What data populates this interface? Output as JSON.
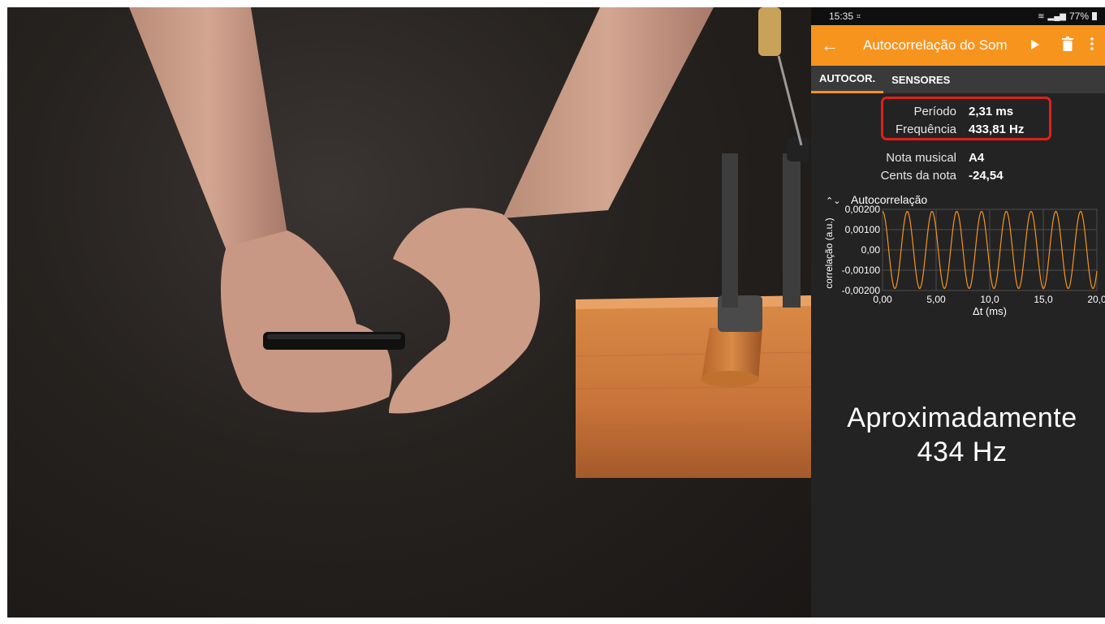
{
  "status_bar": {
    "time": "15:35",
    "battery": "77%"
  },
  "app_bar": {
    "title": "Autocorrelação do Som"
  },
  "tabs": [
    {
      "label": "AUTOCOR."
    },
    {
      "label": "SENSORES"
    }
  ],
  "readout": {
    "period_label": "Período",
    "period_value": "2,31 ms",
    "frequency_label": "Frequência",
    "frequency_value": "433,81 Hz",
    "note_label": "Nota musical",
    "note_value": "A4",
    "cents_label": "Cents da nota",
    "cents_value": "-24,54"
  },
  "chart_data": {
    "type": "line",
    "title": "Autocorrelação",
    "xlabel": "Δt (ms)",
    "ylabel": "correlação (a.u.)",
    "xlim": [
      0,
      20
    ],
    "ylim": [
      -0.002,
      0.002
    ],
    "x_ticks": [
      "0,00",
      "5,00",
      "10,0",
      "15,0",
      "20,0"
    ],
    "y_ticks": [
      "0,00200",
      "0,00100",
      "0,00",
      "-0,00100",
      "-0,00200"
    ],
    "series": [
      {
        "period_ms": 2.31,
        "amplitude": 0.0019,
        "color": "#f7941d"
      }
    ],
    "grid": true
  },
  "caption": {
    "line1": "Aproximadamente",
    "line2": "434 Hz"
  },
  "colors": {
    "accent": "#f7941d",
    "highlight": "#e0201b",
    "background": "#232323"
  }
}
